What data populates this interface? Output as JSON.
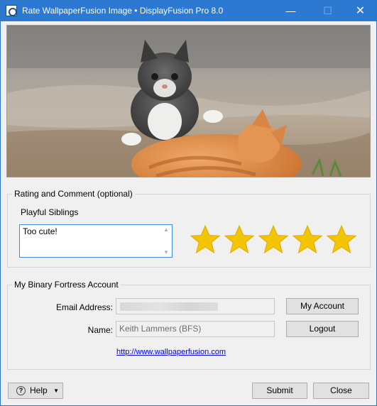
{
  "window": {
    "title": "Rate WallpaperFusion Image • DisplayFusion Pro 8.0",
    "minimize_glyph": "—",
    "maximize_glyph": "☐",
    "close_glyph": "✕"
  },
  "image": {
    "subject": "two kittens playing on dirt ground"
  },
  "rating": {
    "legend": "Rating and Comment (optional)",
    "image_title": "Playful Siblings",
    "comment": "Too cute!",
    "stars_total": 5,
    "stars_selected": 5,
    "star_color": "#f5c400"
  },
  "account": {
    "legend": "My Binary Fortress Account",
    "email_label": "Email Address:",
    "email_value": "",
    "name_label": "Name:",
    "name_value": "Keith Lammers (BFS)",
    "my_account_button": "My Account",
    "logout_button": "Logout",
    "link": "http://www.wallpaperfusion.com"
  },
  "footer": {
    "help_label": "Help",
    "help_icon_glyph": "?",
    "help_arrow_glyph": "▼",
    "submit_label": "Submit",
    "close_label": "Close"
  },
  "colors": {
    "titlebar": "#2b79d2",
    "window_bg": "#f0f0f0",
    "link": "#0000ee"
  }
}
